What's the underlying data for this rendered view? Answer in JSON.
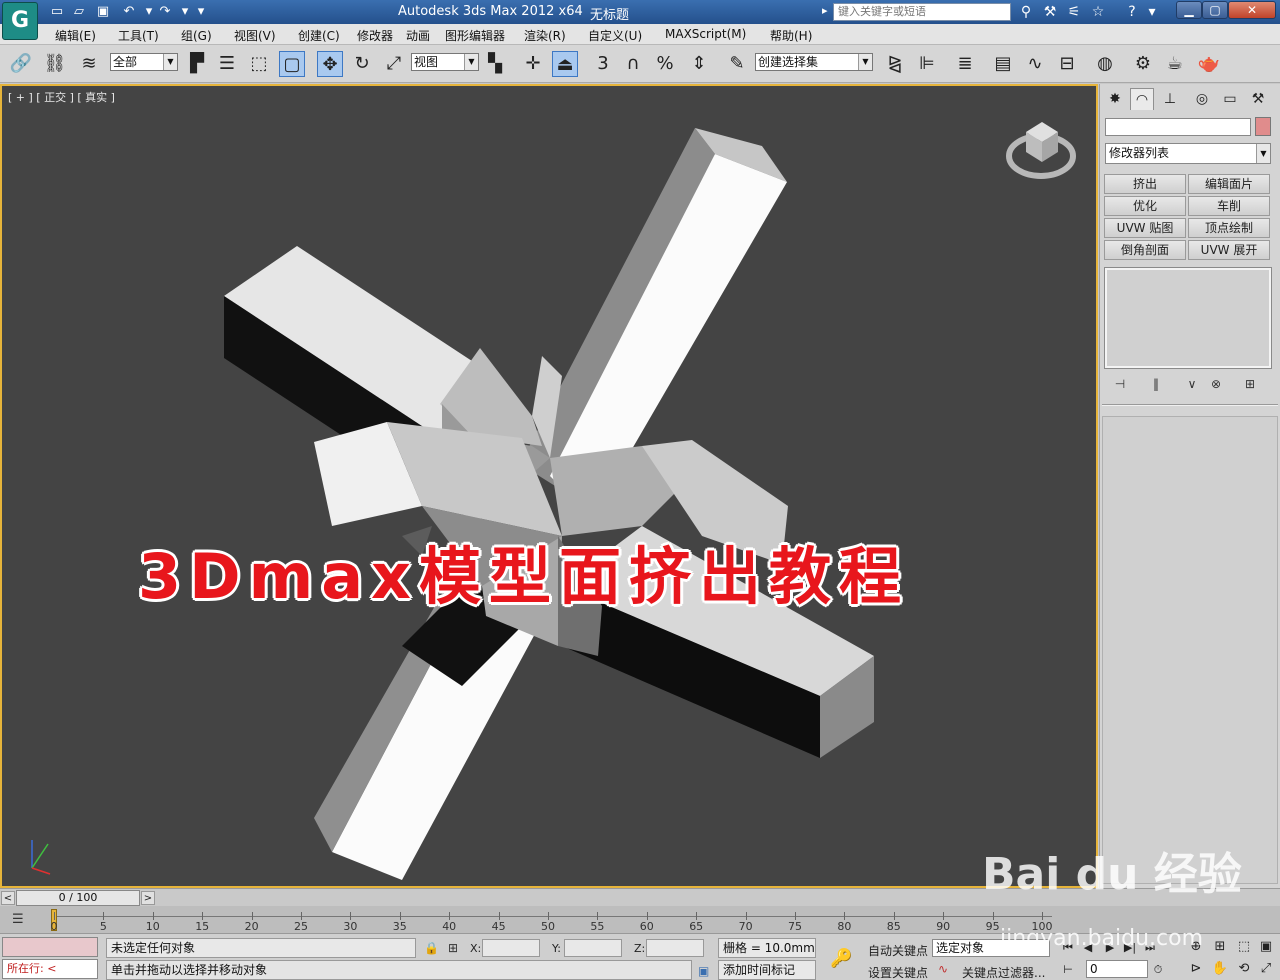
{
  "titlebar": {
    "app_title": "Autodesk 3ds Max  2012 x64",
    "document": "无标题",
    "search_placeholder": "键入关键字或短语"
  },
  "menu": {
    "items": [
      "编辑(E)",
      "工具(T)",
      "组(G)",
      "视图(V)",
      "创建(C)",
      "修改器",
      "动画",
      "图形编辑器",
      "渲染(R)",
      "自定义(U)",
      "MAXScript(M)",
      "帮助(H)"
    ]
  },
  "toolbar": {
    "selection_filter": "全部",
    "ref_coord": "视图",
    "snap_angle": "3",
    "snap_percent": "%",
    "named_selection": "创建选择集"
  },
  "viewport": {
    "label": "[ + ] [ 正交 ] [ 真实 ]",
    "background": "#444444",
    "overlay_title": "3Dmax模型面挤出教程"
  },
  "command_panel": {
    "modifier_list": "修改器列表",
    "buttons": [
      "挤出",
      "编辑面片",
      "优化",
      "车削",
      "UVW 贴图",
      "顶点绘制",
      "倒角剖面",
      "UVW 展开"
    ]
  },
  "timeline": {
    "frame_counter": "0 / 100",
    "ticks": [
      "0",
      "5",
      "10",
      "15",
      "20",
      "25",
      "30",
      "35",
      "40",
      "45",
      "50",
      "55",
      "60",
      "65",
      "70",
      "75",
      "80",
      "85",
      "90",
      "95",
      "100"
    ]
  },
  "status": {
    "maxscript_line": "所在行:",
    "selection_info": "未选定任何对象",
    "prompt": "单击并拖动以选择并移动对象",
    "x_label": "X:",
    "y_label": "Y:",
    "z_label": "Z:",
    "grid": "栅格 = 10.0mm",
    "add_time_tag": "添加时间标记",
    "auto_key": "自动关键点",
    "set_key": "设置关键点",
    "key_mode": "选定对象",
    "key_filters": "关键点过滤器...",
    "current_frame": "0"
  },
  "watermark": {
    "brand": "Bai du 经验",
    "url": "jingyan.baidu.com"
  }
}
